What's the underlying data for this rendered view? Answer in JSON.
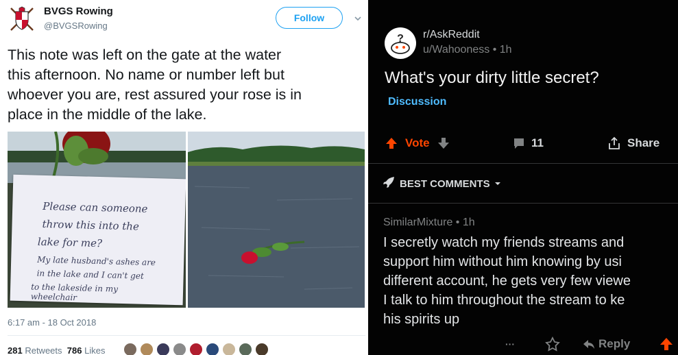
{
  "tweet": {
    "account_name": "BVGS Rowing",
    "handle": "@BVGSRowing",
    "follow_label": "Follow",
    "text_lines": [
      "This note was left on the gate at the water",
      "this afternoon. No name or number left but",
      "whoever you are, rest assured your rose is in",
      "place in the middle of the lake."
    ],
    "note_lines": [
      "Please  can someone",
      "throw this into the",
      "lake for me?",
      "My late husband's ashes are",
      "in the lake and I can't get",
      "to the lakeside in my",
      "wheelchair"
    ],
    "timestamp": "6:17 am - 18 Oct 2018",
    "retweets_count": "281",
    "retweets_label": "Retweets",
    "likes_count": "786",
    "likes_label": "Likes",
    "colors": {
      "accent": "#1da1f2",
      "text": "#14171a",
      "muted": "#657786"
    }
  },
  "reddit": {
    "subreddit": "r/AskReddit",
    "username": "u/Wahooness",
    "post_age": "1h",
    "post_title": "What's your dirty little secret?",
    "flair": "Discussion",
    "vote_label": "Vote",
    "comment_count": "11",
    "share_label": "Share",
    "sort_label": "BEST COMMENTS",
    "comment": {
      "author": "SimilarMixture",
      "age": "1h",
      "lines": [
        "I secretly watch my friends streams and",
        "support him without him knowing by usi",
        "different account, he gets very few viewe",
        "I talk to him throughout the stream to ke",
        "his spirits up"
      ],
      "more_label": "···",
      "reply_label": "Reply"
    },
    "colors": {
      "background": "#030303",
      "upvote": "#ff4500",
      "flair": "#4fbcff",
      "text": "#d7dadc"
    }
  },
  "icons": {
    "avatar": "crest-icon",
    "caret": "chevron-down-icon",
    "upvote": "arrow-up-icon",
    "downvote": "arrow-down-icon",
    "comments": "comment-icon",
    "share": "share-icon",
    "sort": "rocket-icon",
    "award": "award-icon",
    "reply": "reply-icon"
  }
}
